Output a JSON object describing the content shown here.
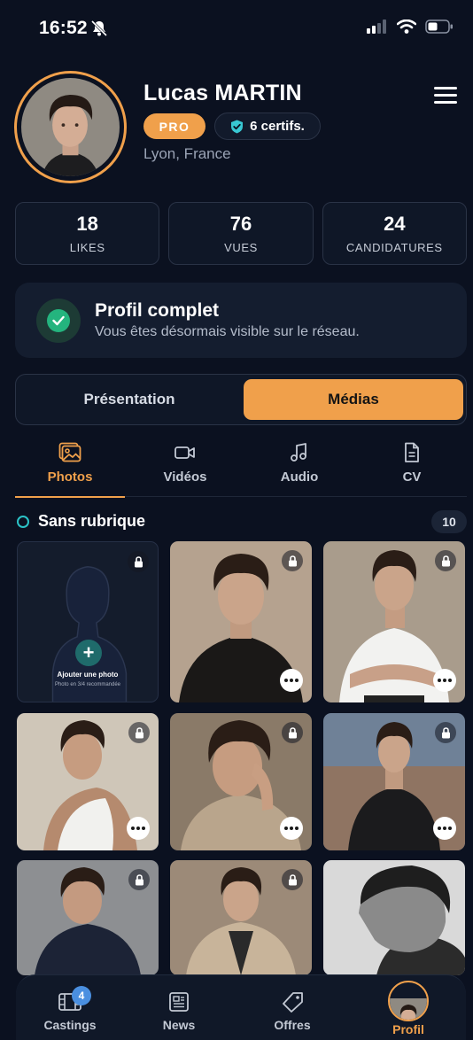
{
  "status_bar": {
    "time": "16:52",
    "icons": [
      "bell-off-icon",
      "cellular-icon",
      "wifi-icon",
      "battery-icon"
    ]
  },
  "profile": {
    "name": "Lucas MARTIN",
    "pro_badge": "PRO",
    "certifications": "6 certifs.",
    "location": "Lyon, France"
  },
  "stats": [
    {
      "value": "18",
      "label": "LIKES"
    },
    {
      "value": "76",
      "label": "VUES"
    },
    {
      "value": "24",
      "label": "CANDIDATURES"
    }
  ],
  "completion": {
    "title": "Profil complet",
    "subtitle": "Vous êtes désormais visible sur le réseau."
  },
  "segments": {
    "presentation": "Présentation",
    "media": "Médias",
    "selected": "Médias"
  },
  "media_tabs": [
    {
      "label": "Photos",
      "icon": "photo-icon",
      "active": true
    },
    {
      "label": "Vidéos",
      "icon": "video-icon",
      "active": false
    },
    {
      "label": "Audio",
      "icon": "music-icon",
      "active": false
    },
    {
      "label": "CV",
      "icon": "document-icon",
      "active": false
    }
  ],
  "section": {
    "title": "Sans rubrique",
    "count": "10"
  },
  "add_photo": {
    "label": "Ajouter une photo",
    "hint": "Photo en 3/4 recommandée"
  },
  "bottom_nav": [
    {
      "label": "Castings",
      "icon": "film-icon",
      "badge": "4",
      "active": false
    },
    {
      "label": "News",
      "icon": "news-icon",
      "active": false
    },
    {
      "label": "Offres",
      "icon": "tag-icon",
      "active": false
    },
    {
      "label": "Profil",
      "icon": "avatar",
      "active": true
    }
  ],
  "colors": {
    "background": "#0b1120",
    "accent": "#f0a04b",
    "success": "#24b47e",
    "teal": "#2bc3c7",
    "badge_blue": "#4a8fe0"
  }
}
